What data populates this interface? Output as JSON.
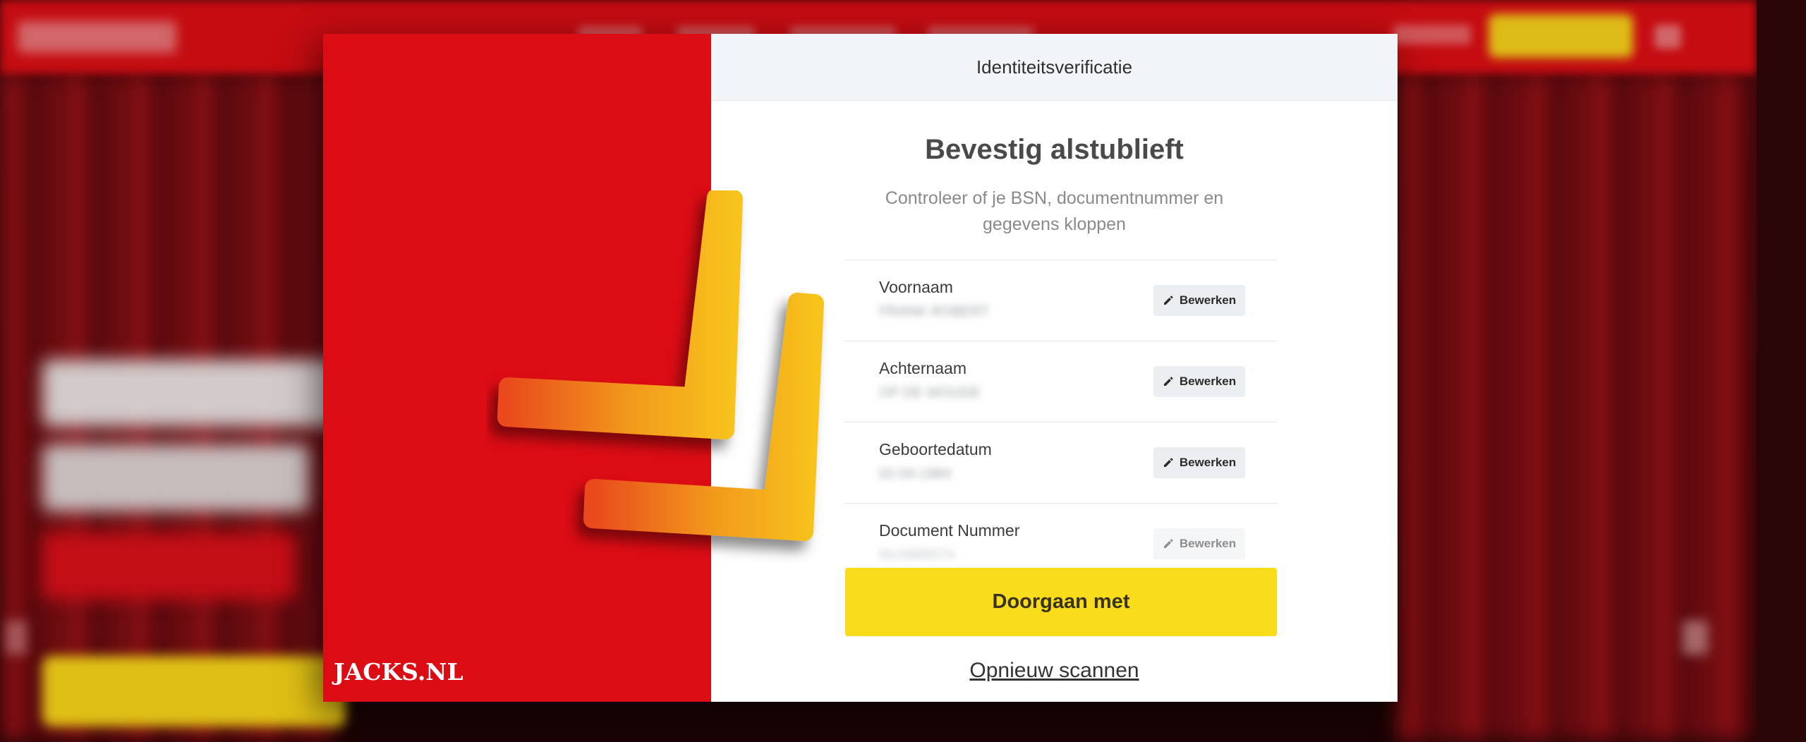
{
  "modal": {
    "header_title": "Identiteitsverificatie",
    "title": "Bevestig alstublieft",
    "subtitle": "Controleer of je BSN, documentnummer en gegevens kloppen",
    "fields": [
      {
        "label": "Voornaam",
        "value": "FRANK ROBERT",
        "edit_label": "Bewerken"
      },
      {
        "label": "Achternaam",
        "value": "OP DE WOUDE",
        "edit_label": "Bewerken"
      },
      {
        "label": "Geboortedatum",
        "value": "02-04-1984",
        "edit_label": "Bewerken"
      },
      {
        "label": "Document Nummer",
        "value": "NU3968574",
        "edit_label": "Bewerken"
      }
    ],
    "continue_label": "Doorgaan met",
    "rescan_label": "Opnieuw scannen"
  },
  "brand": {
    "logo_text": "JACKS.NL"
  },
  "icons": {
    "edit": "pencil-icon",
    "overlay": "double-checkmark-icon"
  },
  "colors": {
    "brand_red": "#dc0c14",
    "accent_yellow": "#f9dc1c",
    "check_gradient_start": "#e94a1a",
    "check_gradient_end": "#f7c31a"
  }
}
